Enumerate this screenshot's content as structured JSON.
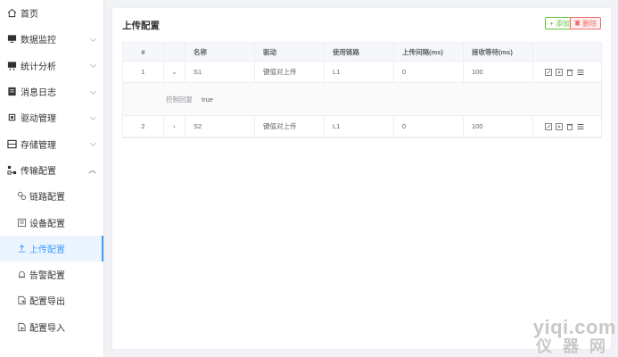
{
  "sidebar": {
    "items": [
      {
        "label": "首页",
        "icon": "home-icon"
      },
      {
        "label": "数据监控",
        "icon": "monitor-icon",
        "arrow": "down"
      },
      {
        "label": "统计分析",
        "icon": "chart-icon",
        "arrow": "down"
      },
      {
        "label": "消息日志",
        "icon": "log-icon",
        "arrow": "down"
      },
      {
        "label": "驱动管理",
        "icon": "chip-icon",
        "arrow": "down"
      },
      {
        "label": "存储管理",
        "icon": "storage-icon",
        "arrow": "down"
      },
      {
        "label": "传输配置",
        "icon": "transfer-icon",
        "arrow": "up"
      }
    ],
    "sub_items": [
      {
        "label": "链路配置",
        "icon": "link-icon"
      },
      {
        "label": "设备配置",
        "icon": "device-icon"
      },
      {
        "label": "上传配置",
        "icon": "upload-icon",
        "active": true
      },
      {
        "label": "告警配置",
        "icon": "alarm-icon"
      },
      {
        "label": "配置导出",
        "icon": "export-icon"
      },
      {
        "label": "配置导入",
        "icon": "import-icon"
      }
    ]
  },
  "main": {
    "title": "上传配置",
    "add_label": "+ 添加",
    "delete_label": "删除",
    "columns": [
      "#",
      "",
      "名称",
      "驱动",
      "使用链路",
      "上传间隔(ms)",
      "接收等待(ms)",
      ""
    ],
    "rows": [
      {
        "index": "1",
        "toggle": "⌄",
        "name": "S1",
        "driver": "键值对上传",
        "link": "L1",
        "interval": "0",
        "wait": "100"
      },
      {
        "index": "2",
        "toggle": "›",
        "name": "S2",
        "driver": "键值对上传",
        "link": "L1",
        "interval": "0",
        "wait": "100"
      }
    ],
    "expanded": {
      "key": "控制回复",
      "value": "true"
    }
  },
  "watermark": {
    "line1": "yiqi.com",
    "line2": "仪器网"
  },
  "colors": {
    "accent": "#409eff",
    "add": "#67c23a",
    "delete": "#f56c6c"
  }
}
